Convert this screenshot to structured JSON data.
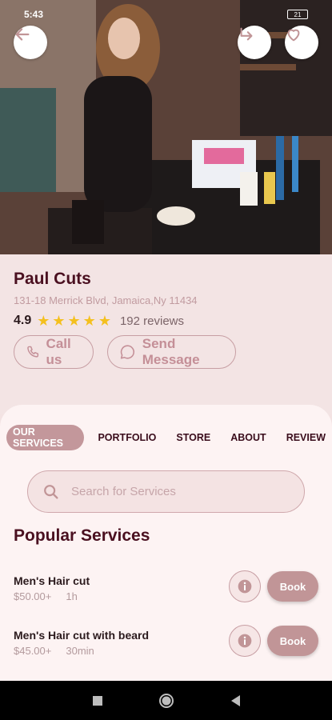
{
  "status": {
    "time": "5:43",
    "battery": "21"
  },
  "shop": {
    "name": "Paul Cuts",
    "address": "131-18 Merrick Blvd, Jamaica,Ny 11434",
    "rating": "4.9",
    "reviews": "192 reviews",
    "stars": 5
  },
  "actions": {
    "call": "Call us",
    "message": "Send Message"
  },
  "tabs": [
    {
      "label": "OUR SERVICES"
    },
    {
      "label": "PORTFOLIO"
    },
    {
      "label": "STORE"
    },
    {
      "label": "ABOUT"
    },
    {
      "label": "REVIEW"
    }
  ],
  "search": {
    "placeholder": "Search for Services"
  },
  "section_title": "Popular Services",
  "services": [
    {
      "name": "Men's Hair cut",
      "price": "$50.00+",
      "duration": "1h",
      "book": "Book"
    },
    {
      "name": "Men's Hair cut with beard",
      "price": "$45.00+",
      "duration": "30min",
      "book": "Book"
    }
  ],
  "colors": {
    "accent": "#c19597",
    "title": "#4a1020",
    "star": "#f4c01e"
  },
  "icons": [
    "back-arrow-icon",
    "share-icon",
    "heart-icon",
    "phone-icon",
    "chat-icon",
    "search-icon",
    "info-icon",
    "square-icon",
    "circle-icon",
    "triangle-icon"
  ]
}
